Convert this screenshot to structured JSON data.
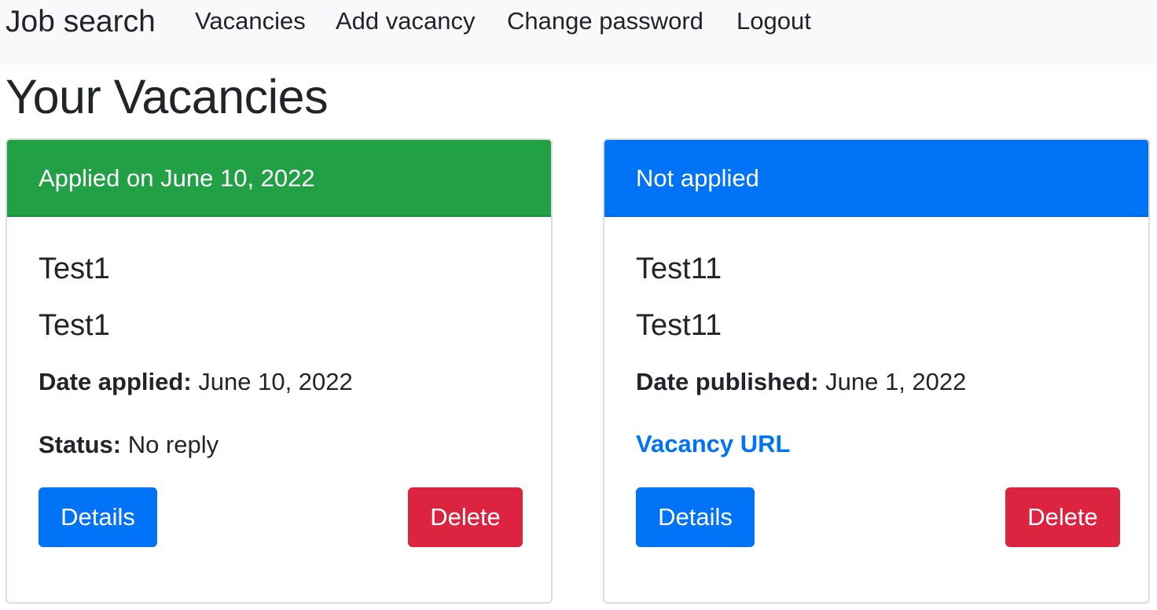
{
  "navbar": {
    "brand": "Job search",
    "links": [
      "Vacancies",
      "Add vacancy",
      "Change password",
      "Logout"
    ]
  },
  "page_title": "Your Vacancies",
  "colors": {
    "success": "#22a046",
    "primary": "#0073f7",
    "danger": "#dc2440",
    "navbar_bg": "#f8f9fa",
    "text": "#212529"
  },
  "cards": [
    {
      "header": "Applied on June 10, 2022",
      "title": "Test1",
      "subtitle": "Test1",
      "date_label": "Date applied:",
      "date_value": " June 10, 2022",
      "status_label": "Status:",
      "status_value": " No reply",
      "details_label": "Details",
      "delete_label": "Delete"
    },
    {
      "header": "Not applied",
      "title": "Test11",
      "subtitle": "Test11",
      "date_label": "Date published:",
      "date_value": " June 1, 2022",
      "link_label": "Vacancy URL",
      "details_label": "Details",
      "delete_label": "Delete"
    }
  ]
}
